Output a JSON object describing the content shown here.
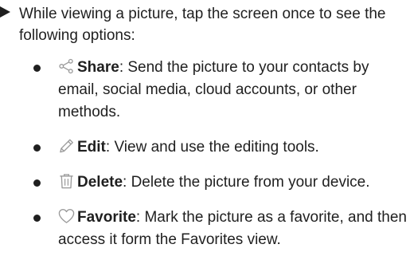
{
  "intro": {
    "text": "While viewing a picture, tap the screen once to see the following options:"
  },
  "options": [
    {
      "icon": "share-icon",
      "term": "Share",
      "description": ": Send the picture to your contacts by email, social media, cloud accounts, or other methods."
    },
    {
      "icon": "edit-icon",
      "term": "Edit",
      "description": ": View and use the editing tools."
    },
    {
      "icon": "delete-icon",
      "term": "Delete",
      "description": ": Delete the picture from your device."
    },
    {
      "icon": "favorite-icon",
      "term": "Favorite",
      "description": ": Mark the picture as a favorite, and then access it form the Favorites view."
    }
  ],
  "colors": {
    "text": "#1f1f1f",
    "icon": "#9a9a9a"
  }
}
